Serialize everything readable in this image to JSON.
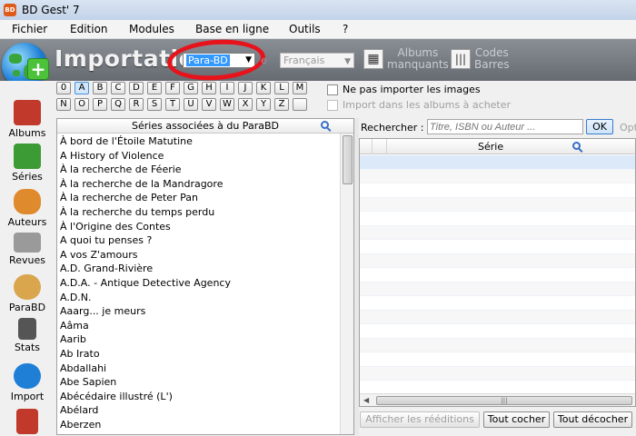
{
  "window": {
    "title": "BD Gest' 7",
    "icon_label": "BD"
  },
  "menu": [
    "Fichier",
    "Edition",
    "Modules",
    "Base en ligne",
    "Outils",
    "?"
  ],
  "header": {
    "title": "Importation",
    "source_selected": "Para-BD",
    "lang_prefix": "e",
    "lang_selected": "Français",
    "albums_missing_line1": "Albums",
    "albums_missing_line2": "manquants",
    "barcodes_line1": "Codes",
    "barcodes_line2": "Barres"
  },
  "sidebar": [
    {
      "label": "Albums",
      "icon": "albums-book-icon",
      "color": "#c0392b"
    },
    {
      "label": "Séries",
      "icon": "series-books-icon",
      "color": "#3d9b35"
    },
    {
      "label": "Auteurs",
      "icon": "authors-people-icon",
      "color": "#e08a2e"
    },
    {
      "label": "Revues",
      "icon": "magazines-icon",
      "color": "#9a9a9a"
    },
    {
      "label": "ParaBD",
      "icon": "parabd-palette-icon",
      "color": "#d9a64e"
    },
    {
      "label": "Stats",
      "icon": "stats-icon",
      "color": "#555555"
    },
    {
      "label": "Import",
      "icon": "import-globe-icon",
      "color": "#1f7fd6"
    },
    {
      "label": "",
      "icon": "calendar-icon",
      "color": "#c0392b"
    }
  ],
  "letters_row1": [
    "0",
    "A",
    "B",
    "C",
    "D",
    "E",
    "F",
    "G",
    "H",
    "I",
    "J",
    "K",
    "L",
    "M"
  ],
  "letters_row2": [
    "N",
    "O",
    "P",
    "Q",
    "R",
    "S",
    "T",
    "U",
    "V",
    "W",
    "X",
    "Y",
    "Z",
    ""
  ],
  "options": {
    "no_images": "Ne pas importer les images",
    "wishlist_import": "Import dans les albums à acheter"
  },
  "series_panel": {
    "header": "Séries associées à du ParaBD",
    "items": [
      "À bord de l'Étoile Matutine",
      "A History of Violence",
      "À la recherche de Féerie",
      "À la recherche de la Mandragore",
      "À la recherche de Peter Pan",
      "À la recherche du temps perdu",
      "À l'Origine des Contes",
      "A quoi tu penses ?",
      "A vos Z'amours",
      "A.D. Grand-Rivière",
      "A.D.A. - Antique Detective Agency",
      "A.D.N.",
      "Aaarg... je meurs",
      "Aâma",
      "Aarib",
      "Ab Irato",
      "Abdallahi",
      "Abe Sapien",
      "Abécédaire illustré (L')",
      "Abélard",
      "Aberzen"
    ]
  },
  "search": {
    "label": "Rechercher :",
    "placeholder": "Titre, ISBN ou Auteur ...",
    "ok": "OK",
    "options_label": "Opt"
  },
  "results": {
    "column_serie": "Série"
  },
  "buttons": {
    "show_reissues": "Afficher les rééditions",
    "check_all": "Tout cocher",
    "uncheck_all": "Tout décocher"
  },
  "colors": {
    "accent": "#3399ff",
    "highlight_circle": "#e8121b",
    "header_bg": "#777c83"
  }
}
